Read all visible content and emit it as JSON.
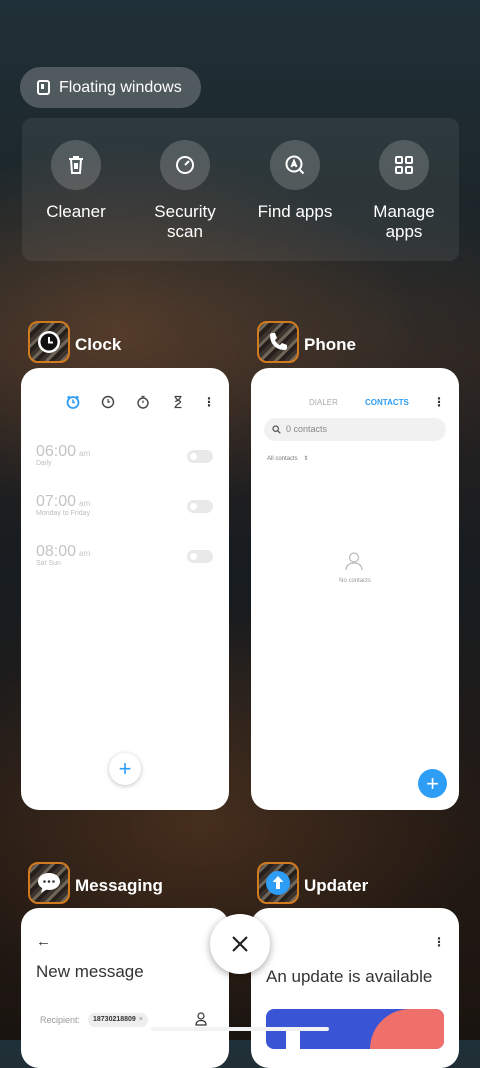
{
  "floating_windows": {
    "label": "Floating windows"
  },
  "quick_actions": [
    {
      "label": "Cleaner",
      "icon": "trash-icon"
    },
    {
      "label": "Security\nscan",
      "icon": "security-scan-icon"
    },
    {
      "label": "Find apps",
      "icon": "find-apps-icon"
    },
    {
      "label": "Manage\napps",
      "icon": "grid-icon"
    }
  ],
  "apps": {
    "clock": {
      "name": "Clock",
      "alarms": [
        {
          "time": "06:00",
          "ampm": "am",
          "repeat": "Daily"
        },
        {
          "time": "07:00",
          "ampm": "am",
          "repeat": "Monday to Friday"
        },
        {
          "time": "08:00",
          "ampm": "am",
          "repeat": "Sat Sun"
        }
      ],
      "fab": "+"
    },
    "phone": {
      "name": "Phone",
      "tabs": {
        "dialer": "DIALER",
        "contacts": "CONTACTS"
      },
      "search_placeholder": "0 contacts",
      "filter": "All contacts",
      "empty": "No contacts",
      "fab": "+"
    },
    "messaging": {
      "name": "Messaging",
      "title": "New message",
      "recipient_label": "Recipient:",
      "recipient_chip": "18730218809"
    },
    "updater": {
      "name": "Updater",
      "title": "An update is available"
    }
  },
  "colors": {
    "accent_blue": "#2e9df5",
    "app_icon_border": "#d17a1f",
    "card_bg": "#ffffff"
  }
}
